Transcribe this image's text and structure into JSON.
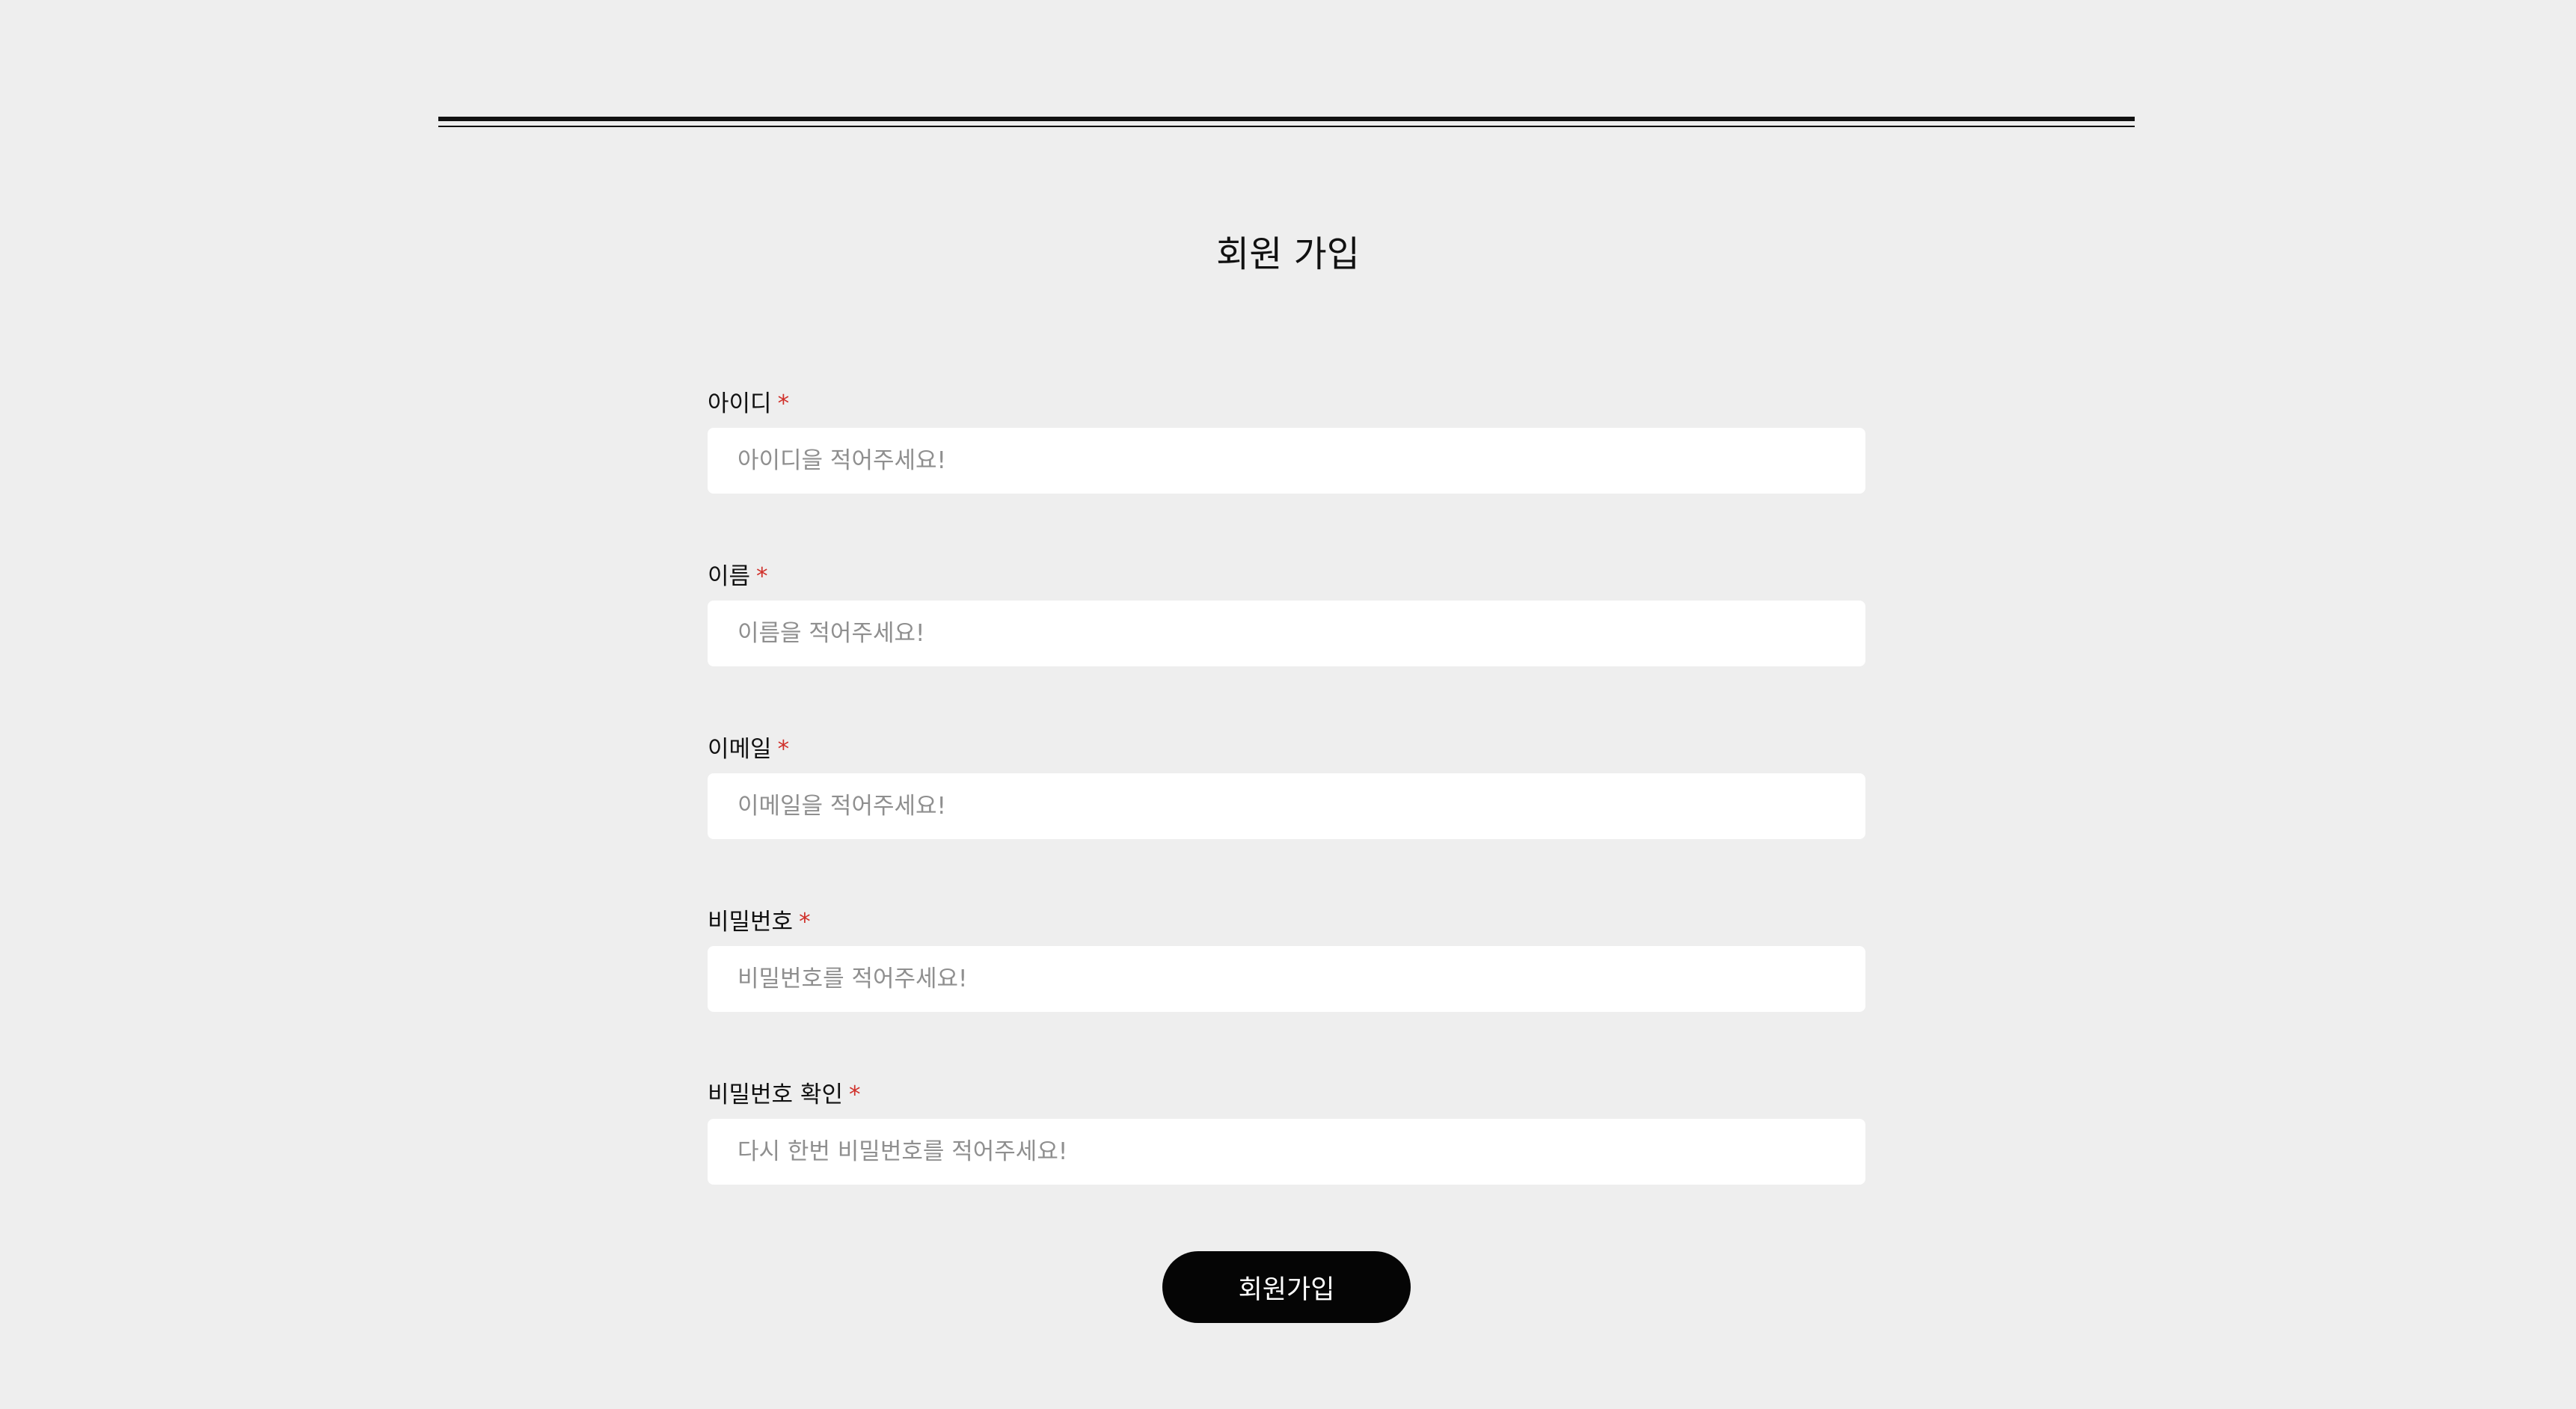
{
  "header": {
    "partial_text_left": "",
    "partial_text_highlight": "",
    "partial_text_right": ""
  },
  "page": {
    "title": "회원 가입"
  },
  "form": {
    "required_mark": "*",
    "fields": [
      {
        "label": "아이디",
        "placeholder": "아이디을 적어주세요!",
        "value": ""
      },
      {
        "label": "이름",
        "placeholder": "이름을 적어주세요!",
        "value": ""
      },
      {
        "label": "이메일",
        "placeholder": "이메일을 적어주세요!",
        "value": ""
      },
      {
        "label": "비밀번호",
        "placeholder": "비밀번호를 적어주세요!",
        "value": ""
      },
      {
        "label": "비밀번호 확인",
        "placeholder": "다시 한번 비밀번호를 적어주세요!",
        "value": ""
      }
    ],
    "submit_label": "회원가입"
  },
  "colors": {
    "background": "#eeeeee",
    "input_background": "#ffffff",
    "required": "#d0302a",
    "button_background": "#050505",
    "button_text": "#ffffff",
    "accent_green": "#4a8a3a"
  }
}
